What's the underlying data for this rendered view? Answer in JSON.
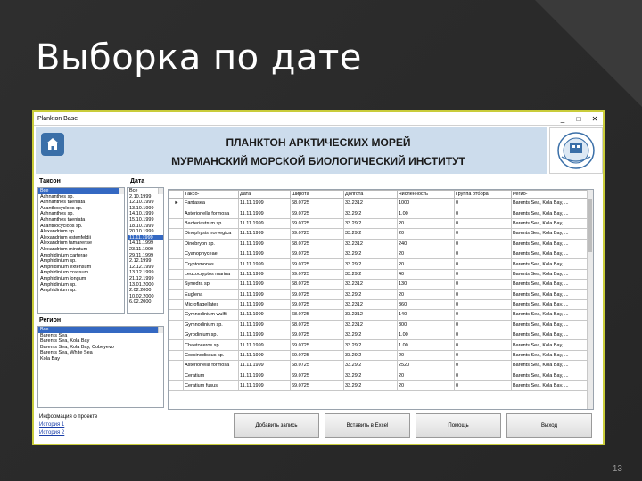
{
  "slide": {
    "title": "Выборка по дате",
    "page_number": "13"
  },
  "window": {
    "title": "Plankton Base",
    "controls": [
      "_",
      "□",
      "✕"
    ]
  },
  "banner": {
    "line1": "ПЛАНКТОН АРКТИЧЕСКИХ МОРЕЙ",
    "line2": "МУРМАНСКИЙ МОРСКОЙ БИОЛОГИЧЕСКИЙ ИНСТИТУТ",
    "home_icon": "home-icon",
    "logo_icon": "institute-logo"
  },
  "taxon_panel": {
    "label": "Таксон",
    "items": [
      "Все",
      "Achnanthes sp.",
      "Achnanthes taeniata",
      "Acanthocyclops sp.",
      "Achnanthes sp.",
      "Achnanthes taeniata",
      "Acanthocyclops sp.",
      "Alexandrium sp.",
      "Alexandrium ostenfeldii",
      "Alexandrium tamarense",
      "Alexandrium minutum",
      "Amphidinium carterae",
      "Amphidinium sp.",
      "Amphidinium extensum",
      "Amphidinium crassum",
      "Amphidinium longum",
      "Amphidinium sp.",
      "Amphidinium sp."
    ],
    "selected_index": 0
  },
  "date_panel": {
    "label": "Дата",
    "items": [
      "Все",
      "2.10.1999",
      "12.10.1999",
      "13.10.1999",
      "14.10.1999",
      "15.10.1999",
      "18.10.1999",
      "20.10.1999",
      "11.11.1999",
      "14.11.1999",
      "23.11.1999",
      "29.11.1999",
      "2.12.1999",
      "12.12.1999",
      "13.12.1999",
      "21.12.1999",
      "13.01.2000",
      "2.02.2000",
      "10.02.2000",
      "6.02.2000"
    ],
    "selected_index": 8
  },
  "region_panel": {
    "label": "Регион",
    "items": [
      "Все",
      "Barents Sea",
      "Barents Sea, Kola Bay",
      "Barents Sea, Kola Bay, Cobeyevo",
      "Barents Sea, White Sea",
      "Kola Bay"
    ],
    "selected_index": 0
  },
  "grid": {
    "columns": [
      "Таксо-",
      "Дата",
      "Широта",
      "Долгота",
      "Численность",
      "Группа отборa",
      "Регио-"
    ],
    "rows": [
      {
        "indicator": "►",
        "cells": [
          "Fantasea",
          "11.11.1999",
          "68.0725",
          "33.2312",
          "1000",
          "0",
          "Barents Sea, Kola Bay, ..."
        ]
      },
      {
        "indicator": "",
        "cells": [
          "Asterionella formosa",
          "11.11.1999",
          "69.0725",
          "33.29.2",
          "1.00",
          "0",
          "Barents Sea, Kola Bay, ..."
        ]
      },
      {
        "indicator": "",
        "cells": [
          "Bacteriastrum sp.",
          "11.11.1999",
          "69.0725",
          "33.29.2",
          "20",
          "0",
          "Barents Sea, Kola Bay, ..."
        ]
      },
      {
        "indicator": "",
        "cells": [
          "Dinophysis norvegica",
          "11.11.1999",
          "69.0725",
          "33.29.2",
          "20",
          "0",
          "Barents Sea, Kola Bay, ..."
        ]
      },
      {
        "indicator": "",
        "cells": [
          "Dinobryon sp.",
          "11.11.1999",
          "68.0725",
          "33.2312",
          "240",
          "0",
          "Barents Sea, Kola Bay, ..."
        ]
      },
      {
        "indicator": "",
        "cells": [
          "Cyanophyceae",
          "11.11.1999",
          "69.0725",
          "33.29.2",
          "20",
          "0",
          "Barents Sea, Kola Bay, ..."
        ]
      },
      {
        "indicator": "",
        "cells": [
          "Cryptomonas",
          "11.11.1999",
          "69.0725",
          "33.29.2",
          "20",
          "0",
          "Barents Sea, Kola Bay, ..."
        ]
      },
      {
        "indicator": "",
        "cells": [
          "Leucocryptos marina",
          "11.11.1999",
          "69.0725",
          "33.29.2",
          "40",
          "0",
          "Barents Sea, Kola Bay, ..."
        ]
      },
      {
        "indicator": "",
        "cells": [
          "Synedra sp.",
          "11.11.1999",
          "68.0725",
          "33.2312",
          "130",
          "0",
          "Barents Sea, Kola Bay, ..."
        ]
      },
      {
        "indicator": "",
        "cells": [
          "Euglena",
          "11.11.1999",
          "69.0725",
          "33.29.2",
          "20",
          "0",
          "Barents Sea, Kola Bay, ..."
        ]
      },
      {
        "indicator": "",
        "cells": [
          "Microflagellates",
          "11.11.1999",
          "69.0725",
          "33.2312",
          "360",
          "0",
          "Barents Sea, Kola Bay, ..."
        ]
      },
      {
        "indicator": "",
        "cells": [
          "Gymnodinium wulfii",
          "11.11.1999",
          "68.0725",
          "33.2312",
          "140",
          "0",
          "Barents Sea, Kola Bay, ..."
        ]
      },
      {
        "indicator": "",
        "cells": [
          "Gymnodinium sp.",
          "11.11.1999",
          "68.0725",
          "33.2312",
          "300",
          "0",
          "Barents Sea, Kola Bay, ..."
        ]
      },
      {
        "indicator": "",
        "cells": [
          "Gyrodinium sp.",
          "11.11.1999",
          "69.0725",
          "33.29.2",
          "1.00",
          "0",
          "Barents Sea, Kola Bay, ..."
        ]
      },
      {
        "indicator": "",
        "cells": [
          "Chaetoceros sp.",
          "11.11.1999",
          "69.0725",
          "33.29.2",
          "1.00",
          "0",
          "Barents Sea, Kola Bay, ..."
        ]
      },
      {
        "indicator": "",
        "cells": [
          "Coscinodiscus sp.",
          "11.11.1999",
          "69.0725",
          "33.29.2",
          "20",
          "0",
          "Barents Sea, Kola Bay, ..."
        ]
      },
      {
        "indicator": "",
        "cells": [
          "Asterionella formosa",
          "11.11.1999",
          "68.0725",
          "33.29.2",
          "2520",
          "0",
          "Barents Sea, Kola Bay, ..."
        ]
      },
      {
        "indicator": "",
        "cells": [
          "Ceratium",
          "11.11.1999",
          "69.0725",
          "33.29.2",
          "20",
          "0",
          "Barents Sea, Kola Bay, ..."
        ]
      },
      {
        "indicator": "",
        "cells": [
          "Ceratium fusus",
          "11.11.1999",
          "69.0725",
          "33.29.2",
          "20",
          "0",
          "Barents Sea, Kola Bay, ..."
        ]
      }
    ]
  },
  "footer": {
    "info_text": "Информация о проекте",
    "link1": "История 1",
    "link2": "История 2",
    "btn_add": "Добавить запись",
    "btn_ready": "Вставить в Excel",
    "btn_help": "Помощь",
    "btn_exit": "Выход"
  }
}
